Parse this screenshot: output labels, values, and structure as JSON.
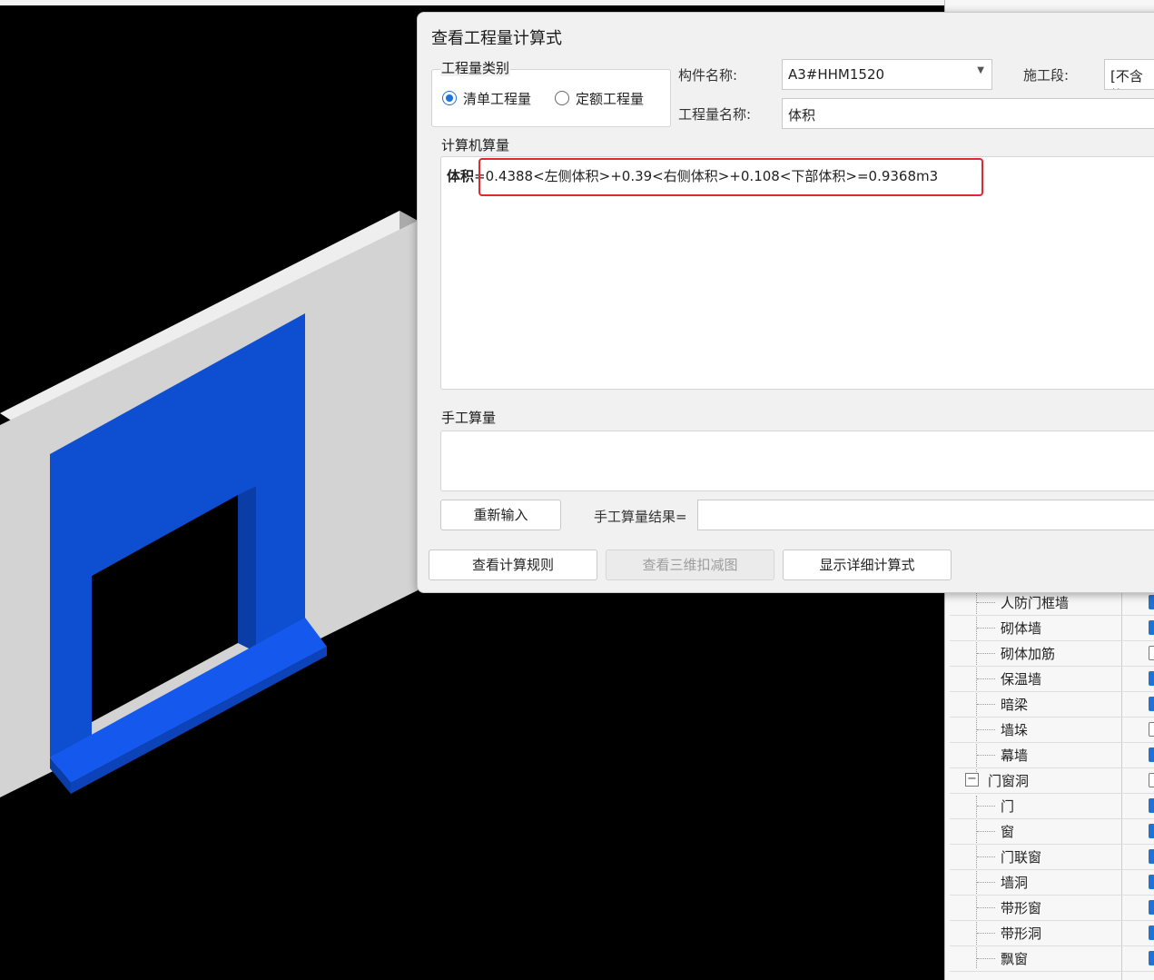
{
  "dialog": {
    "title": "查看工程量计算式",
    "quantity_type_group": {
      "label": "工程量类别",
      "options": [
        {
          "label": "清单工程量",
          "selected": true
        },
        {
          "label": "定额工程量",
          "selected": false
        }
      ]
    },
    "component_name": {
      "label": "构件名称:",
      "value": "A3#HHM1520"
    },
    "construction_section": {
      "label": "施工段:",
      "value": "[不含施"
    },
    "quantity_name": {
      "label": "工程量名称:",
      "value": "体积"
    },
    "computer_calc": {
      "label": "计算机算量",
      "formula_name": "体积",
      "formula_expr": "=0.4388<左侧体积>+0.39<右侧体积>+0.108<下部体积>=0.9368m3"
    },
    "manual_calc": {
      "label": "手工算量",
      "reenter_label": "重新输入",
      "result_label": "手工算量结果="
    },
    "footer_buttons": {
      "rules": "查看计算规则",
      "view_3d": "查看三维扣减图",
      "details": "显示详细计算式"
    }
  },
  "tree": {
    "items": [
      {
        "label": "人防门框墙",
        "checked": true
      },
      {
        "label": "砌体墙",
        "checked": true
      },
      {
        "label": "砌体加筋",
        "checked": false
      },
      {
        "label": "保温墙",
        "checked": true
      },
      {
        "label": "暗梁",
        "checked": true
      },
      {
        "label": "墙垛",
        "checked": false
      },
      {
        "label": "幕墙",
        "checked": true
      },
      {
        "label": "门窗洞",
        "checked": false,
        "group": true,
        "expander": "−"
      },
      {
        "label": "门",
        "checked": true
      },
      {
        "label": "窗",
        "checked": true
      },
      {
        "label": "门联窗",
        "checked": true
      },
      {
        "label": "墙洞",
        "checked": true
      },
      {
        "label": "带形窗",
        "checked": true
      },
      {
        "label": "带形洞",
        "checked": true
      },
      {
        "label": "飘窗",
        "checked": true
      }
    ]
  },
  "colors": {
    "viewport_bg": "#000000",
    "wall_gray": "#d3d3d3",
    "door_frame_blue": "#0e4fd1",
    "highlight_red": "#e0282e",
    "accent_blue": "#1e73d8"
  }
}
